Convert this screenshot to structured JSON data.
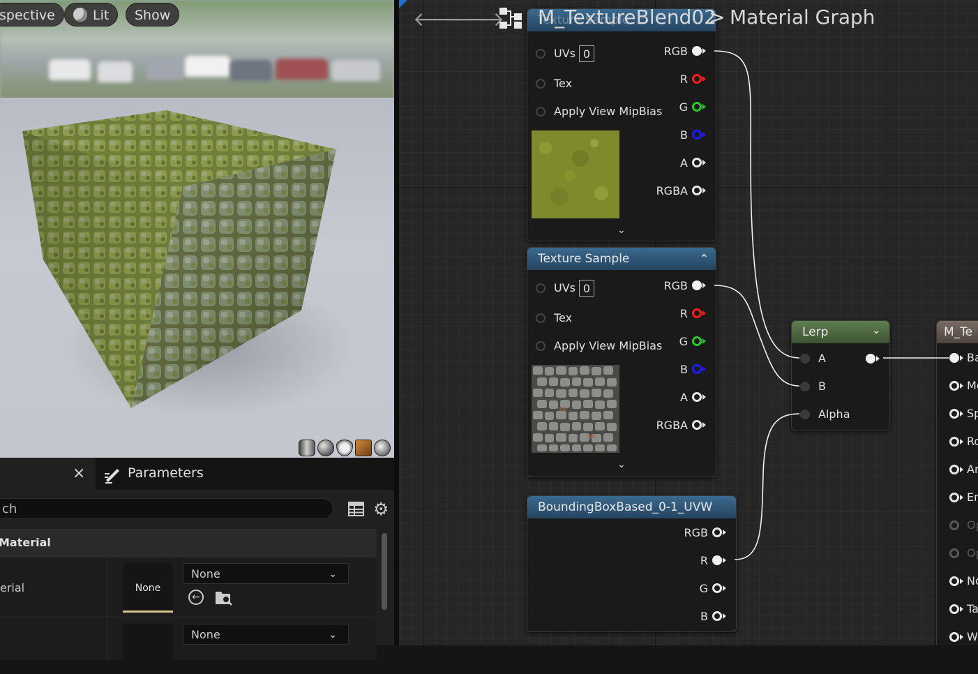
{
  "viewport": {
    "buttons": [
      {
        "label": "spective"
      },
      {
        "label": "Lit"
      },
      {
        "label": "Show"
      }
    ],
    "preview_shapes": [
      "cylinder-icon",
      "sphere-icon",
      "plane-icon",
      "cube-icon",
      "teapot-icon"
    ]
  },
  "panel": {
    "tab_left_close": "×",
    "tab_parameters_label": "Parameters",
    "search_placeholder": "ch",
    "section_title": "Material",
    "rows": [
      {
        "label": "erial",
        "thumb": "None",
        "dropdown": "None"
      },
      {
        "label": "",
        "thumb": "",
        "dropdown": "None"
      }
    ]
  },
  "graph": {
    "breadcrumb": {
      "asset": "M_TextureBlend02",
      "separator": ">",
      "graph": "Material Graph"
    },
    "nodes": {
      "tex1": {
        "title": "Texture Sample",
        "inputs": [
          {
            "label": "UVs",
            "value": "0"
          },
          {
            "label": "Tex"
          },
          {
            "label": "Apply View MipBias"
          }
        ],
        "outputs": [
          "RGB",
          "R",
          "G",
          "B",
          "A",
          "RGBA"
        ]
      },
      "tex2": {
        "title": "Texture Sample",
        "inputs": [
          {
            "label": "UVs",
            "value": "0"
          },
          {
            "label": "Tex"
          },
          {
            "label": "Apply View MipBias"
          }
        ],
        "outputs": [
          "RGB",
          "R",
          "G",
          "B",
          "A",
          "RGBA"
        ]
      },
      "bbox": {
        "title": "BoundingBoxBased_0-1_UVW",
        "outputs": [
          "RGB",
          "R",
          "G",
          "B"
        ]
      },
      "lerp": {
        "title": "Lerp",
        "inputs": [
          "A",
          "B",
          "Alpha"
        ]
      },
      "result": {
        "title": "M_Te",
        "inputs": [
          "Ba",
          "Me",
          "Sp",
          "Ro",
          "An",
          "En",
          "Op",
          "Op",
          "No",
          "Ta",
          "Wo"
        ]
      }
    },
    "colors": {
      "pin_r": "#ff1a1a",
      "pin_g": "#22cc22",
      "pin_b": "#1a1aff",
      "wire": "#f0f0f0"
    }
  }
}
